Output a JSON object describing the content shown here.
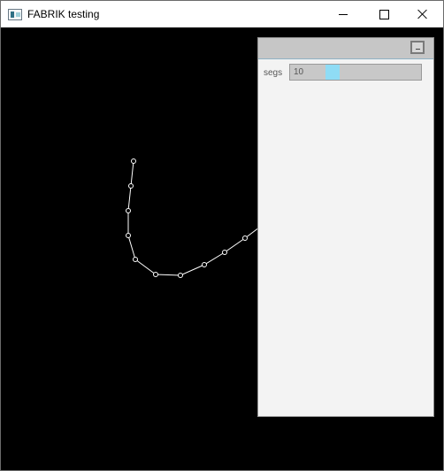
{
  "window": {
    "title": "FABRIK testing",
    "app_icon": "app-icon",
    "controls": [
      {
        "name": "minimize",
        "icon": "minimize-icon"
      },
      {
        "name": "maximize",
        "icon": "maximize-icon"
      },
      {
        "name": "close",
        "icon": "close-icon"
      }
    ]
  },
  "chain": {
    "color": "#ffffff"
  },
  "panel": {
    "minimize_icon": "panel-minimize-icon",
    "slider": {
      "label": "segs",
      "value": "10",
      "fraction": 0.3,
      "handle_color": "#8fdcf5"
    }
  }
}
